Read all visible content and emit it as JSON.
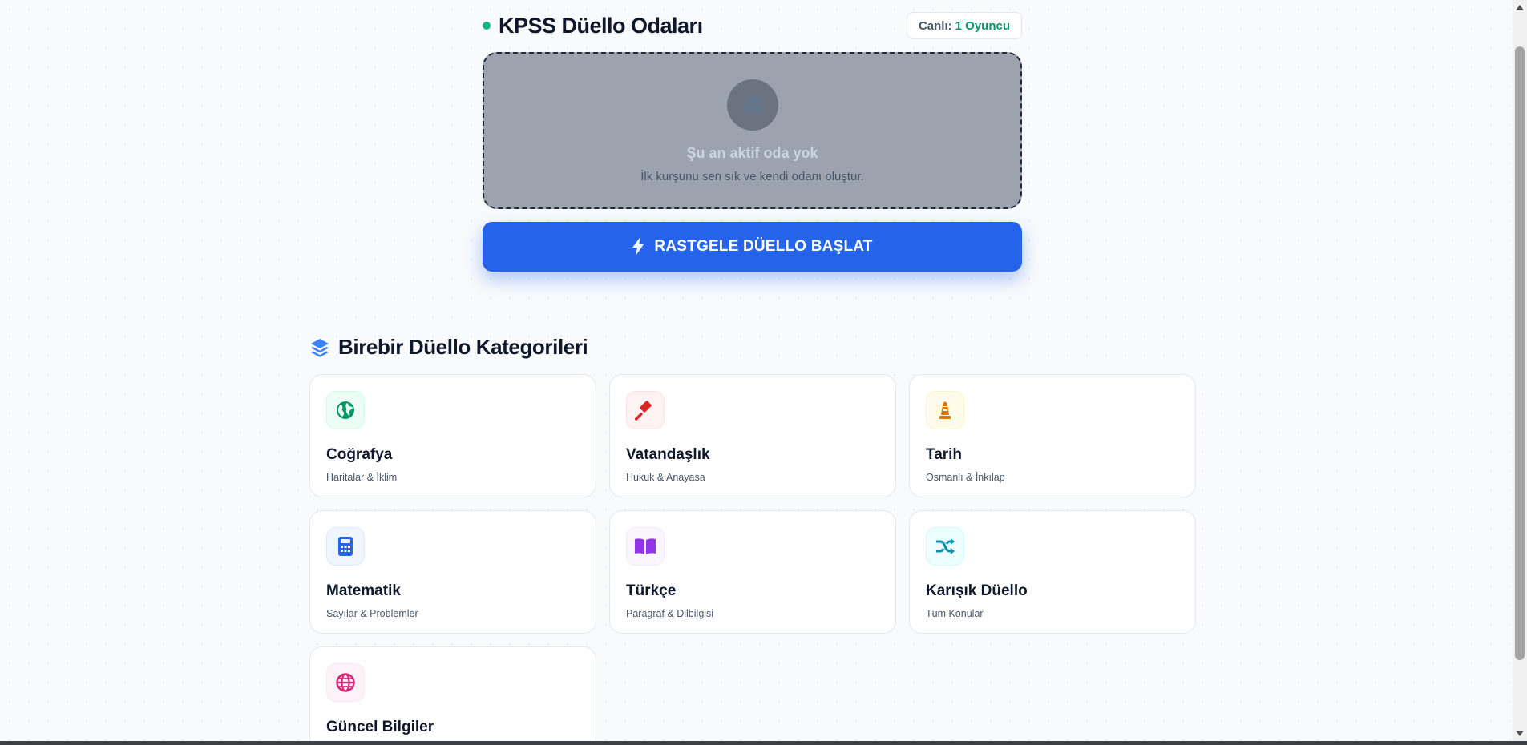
{
  "header": {
    "title": "KPSS Düello Odaları",
    "live_label": "Canlı:",
    "live_count": "1 Oyuncu"
  },
  "empty_state": {
    "title": "Şu an aktif oda yok",
    "subtitle": "İlk kurşunu sen sık ve kendi odanı oluştur.",
    "icon": "ghost-icon"
  },
  "random_button": {
    "label": "RASTGELE DÜELLO BAŞLAT",
    "icon": "bolt-icon"
  },
  "categories": {
    "heading": "Birebir Düello Kategorileri",
    "heading_icon": "layers-icon",
    "items": [
      {
        "title": "Coğrafya",
        "subtitle": "Haritalar & İklim",
        "icon": "globe-earth-icon",
        "color": "#059669",
        "bg": "#ecfdf5"
      },
      {
        "title": "Vatandaşlık",
        "subtitle": "Hukuk & Anayasa",
        "icon": "gavel-icon",
        "color": "#dc2626",
        "bg": "#fef2f2"
      },
      {
        "title": "Tarih",
        "subtitle": "Osmanlı & İnkılap",
        "icon": "chess-rook-icon",
        "color": "#d97706",
        "bg": "#fffbeb"
      },
      {
        "title": "Matematik",
        "subtitle": "Sayılar & Problemler",
        "icon": "calculator-icon",
        "color": "#2563eb",
        "bg": "#eff6ff"
      },
      {
        "title": "Türkçe",
        "subtitle": "Paragraf & Dilbilgisi",
        "icon": "book-open-icon",
        "color": "#9333ea",
        "bg": "#faf5ff"
      },
      {
        "title": "Karışık Düello",
        "subtitle": "Tüm Konular",
        "icon": "shuffle-icon",
        "color": "#0891b2",
        "bg": "#ecfeff"
      },
      {
        "title": "Güncel Bilgiler",
        "subtitle": "",
        "icon": "globe-icon",
        "color": "#db2777",
        "bg": "#fdf2f8"
      }
    ]
  },
  "colors": {
    "accent": "#2563eb",
    "live": "#10b981"
  }
}
